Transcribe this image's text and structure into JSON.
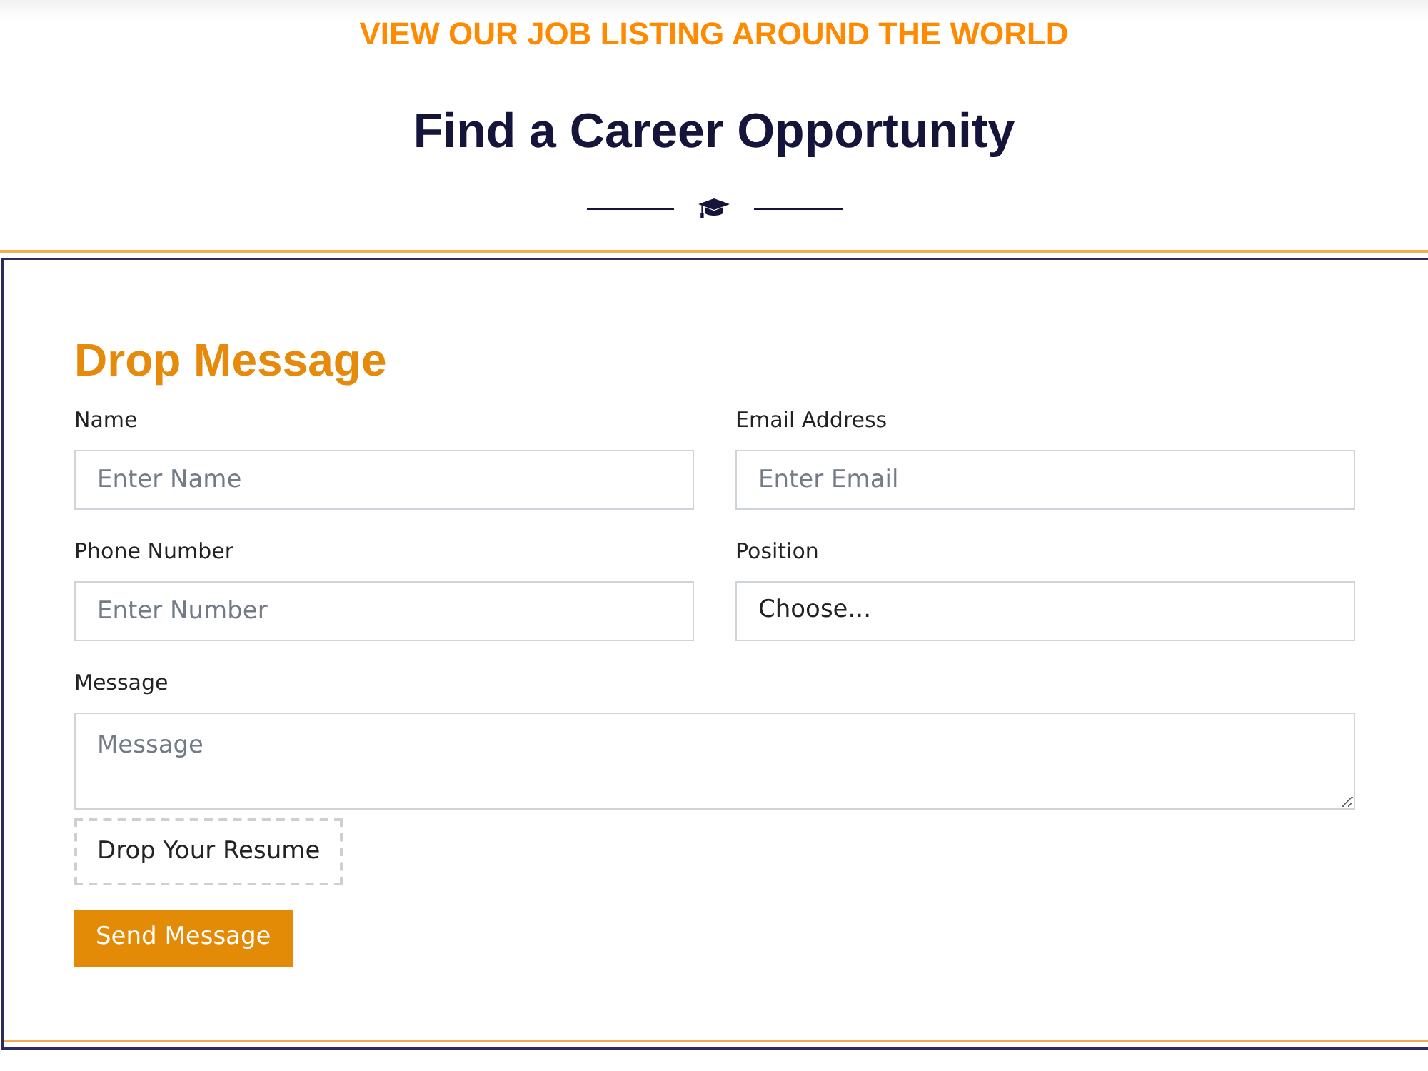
{
  "header": {
    "eyebrow": "VIEW OUR JOB LISTING AROUND THE WORLD",
    "title": "Find a Career Opportunity"
  },
  "form": {
    "title": "Drop Message",
    "fields": [
      {
        "kind": "input",
        "label": "Name",
        "placeholder": "Enter Name"
      },
      {
        "kind": "input",
        "label": "Email Address",
        "placeholder": "Enter Email"
      },
      {
        "kind": "input",
        "label": "Phone Number",
        "placeholder": "Enter Number"
      },
      {
        "kind": "select",
        "label": "Position",
        "value": "Choose..."
      },
      {
        "kind": "textarea",
        "label": "Message",
        "placeholder": "Message"
      }
    ],
    "upload": "Drop Your Resume",
    "submit": "Send Message"
  }
}
